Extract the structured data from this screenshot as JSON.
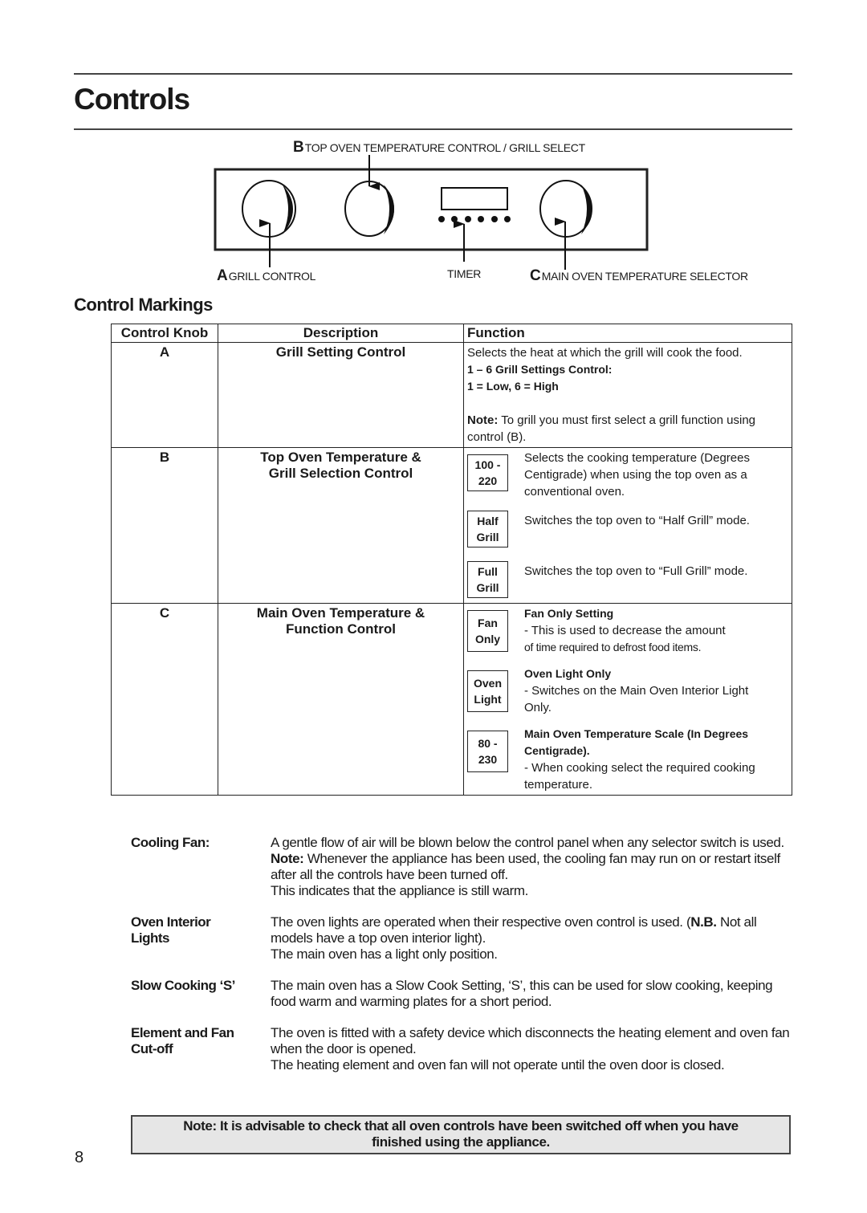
{
  "page": {
    "title": "Controls",
    "number": "8"
  },
  "diagram": {
    "label_b_letter": "B",
    "label_b_text": "TOP OVEN TEMPERATURE CONTROL / GRILL SELECT",
    "label_a_letter": "A",
    "label_a_text": "GRILL CONTROL",
    "label_timer": "TIMER",
    "label_c_letter": "C",
    "label_c_text": "MAIN OVEN TEMPERATURE SELECTOR"
  },
  "markings": {
    "heading": "Control Markings",
    "headers": {
      "knob": "Control Knob",
      "description": "Description",
      "function": "Function"
    },
    "rows": [
      {
        "knob": "A",
        "description": "Grill Setting Control",
        "function_text": "Selects the heat at which the grill will cook the food.",
        "settings_title": "1 – 6 Grill Settings Control:",
        "settings_range": "1 = Low, 6 = High",
        "note_label": "Note:",
        "note_text": " To grill you must first select a grill function using control (B)."
      },
      {
        "knob": "B",
        "description_line1": "Top Oven Temperature &",
        "description_line2": "Grill Selection Control",
        "marks": [
          {
            "box_line1": "100 -",
            "box_line2": "220",
            "text": "Selects the cooking temperature (Degrees Centigrade) when using the top oven as a conventional oven."
          },
          {
            "box_line1": "Half",
            "box_line2": "Grill",
            "text": "Switches the top oven to “Half Grill” mode."
          },
          {
            "box_line1": "Full",
            "box_line2": "Grill",
            "text": "Switches the top oven to “Full Grill” mode."
          }
        ]
      },
      {
        "knob": "C",
        "description_line1": "Main Oven Temperature &",
        "description_line2": "Function Control",
        "marks": [
          {
            "box_line1": "Fan",
            "box_line2": "Only",
            "title": "Fan Only Setting",
            "line1": "-  This is used to decrease the amount",
            "line2": "of time required to defrost food items."
          },
          {
            "box_line1": "Oven",
            "box_line2": "Light",
            "title": "Oven Light Only",
            "line1": "-  Switches on the Main Oven Interior Light Only."
          },
          {
            "box_line1": "80 -",
            "box_line2": "230",
            "title": "Main Oven Temperature Scale (In Degrees Centigrade).",
            "line1": "-  When cooking select the required cooking temperature."
          }
        ]
      }
    ]
  },
  "notes": [
    {
      "term": "Cooling Fan:",
      "para1": "A gentle flow of air will be blown below the control panel when any selector switch is used.",
      "note_label": "Note:",
      "para2": " Whenever the appliance has been used, the cooling fan may run on or restart itself after all the controls have been turned off.",
      "para3": "This indicates that the appliance is still warm."
    },
    {
      "term": "Oven Interior Lights",
      "para1_pre": "The oven lights are operated when their respective oven control is used. (",
      "nb_label": "N.B.",
      "para1_post": " Not all models have a top oven interior light).",
      "para2": "The main oven has a light only position."
    },
    {
      "term": "Slow Cooking ‘S’",
      "para1": "The main oven  has a Slow Cook Setting, ‘S’, this can be used for slow cooking, keeping food warm and warming plates for a short period."
    },
    {
      "term": "Element and Fan Cut-off",
      "para1": "The oven is fitted with a safety device which disconnects the heating element and oven fan when the door is opened.",
      "para2": "The heating element and oven fan will not operate until the oven door is closed."
    }
  ],
  "warning": {
    "line1": "Note: It is advisable to check that all oven controls have been switched off when you have",
    "line2": "finished using the appliance."
  }
}
